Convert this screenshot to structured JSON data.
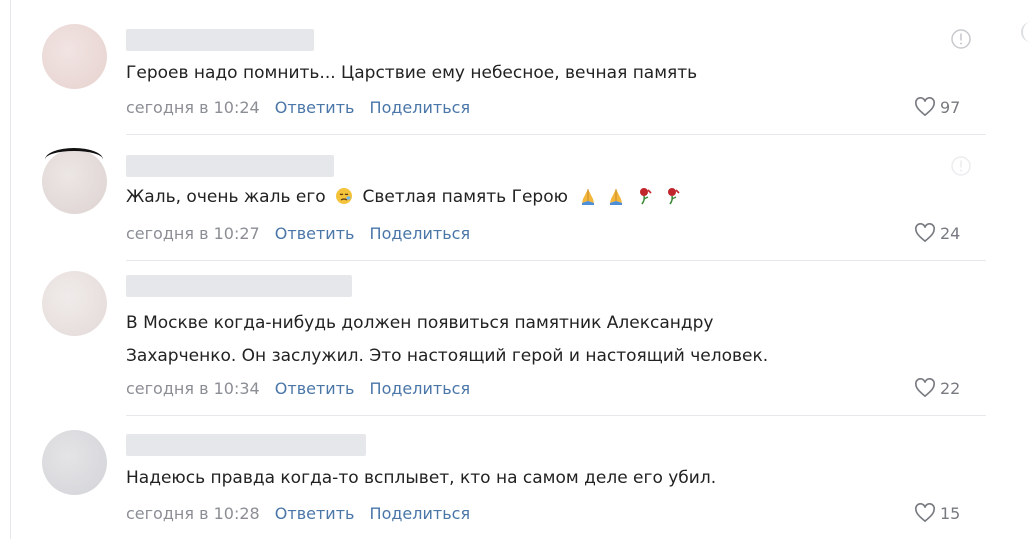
{
  "comments": [
    {
      "text": "Героев надо помнить... Царствие ему небесное, вечная память",
      "date": "сегодня в 10:24",
      "reply_label": "Ответить",
      "share_label": "Поделиться",
      "likes": "97"
    },
    {
      "text_a": "Жаль, очень жаль его",
      "text_b": "Светлая память Герою",
      "emoji": [
        "sad-face-emoji",
        "praying-hands-emoji",
        "praying-hands-emoji",
        "wilted-rose-emoji",
        "wilted-rose-emoji"
      ],
      "date": "сегодня в 10:27",
      "reply_label": "Ответить",
      "share_label": "Поделиться",
      "likes": "24"
    },
    {
      "text_line1": "В Москве когда-нибудь должен появиться памятник Александру",
      "text_line2": "Захарченко. Он заслужил. Это настоящий герой и настоящий человек.",
      "date": "сегодня в 10:34",
      "reply_label": "Ответить",
      "share_label": "Поделиться",
      "likes": "22"
    },
    {
      "text": "Надеюсь правда когда-то всплывет, кто на самом деле его убил.",
      "date": "сегодня в 10:28",
      "reply_label": "Ответить",
      "share_label": "Поделиться",
      "likes": "15"
    }
  ],
  "colors": {
    "link": "#4a76a8",
    "meta": "#8b8e94",
    "text": "#222222",
    "redacted": "#e5e7ea"
  }
}
